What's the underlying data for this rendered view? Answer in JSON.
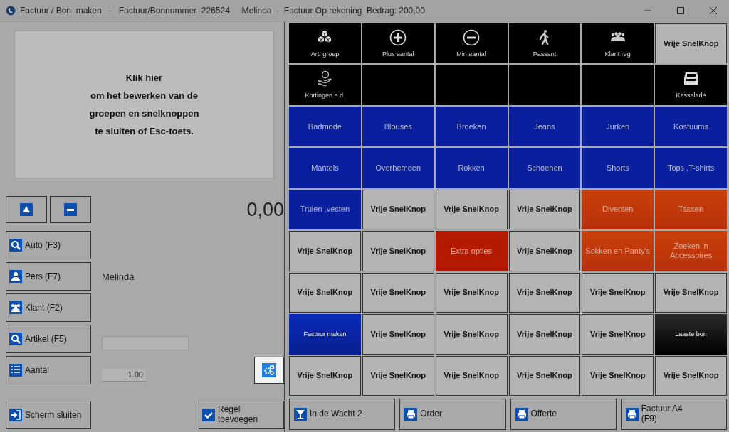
{
  "window": {
    "title": "Factuur / Bon  maken   -   Factuur/Bonnummer  226524     Melinda  -  Factuur Op rekening  Bedrag: 200,00"
  },
  "info": {
    "lines": [
      "Klik hier",
      "om het bewerken van de",
      "groepen en snelknoppen",
      "te sluiten of Esc-toets."
    ]
  },
  "amount": "0,00",
  "side_buttons": [
    {
      "label": "Auto (F3)"
    },
    {
      "label": "Pers (F7)"
    },
    {
      "label": "Klant (F2)"
    },
    {
      "label": "Artikel (F5)"
    },
    {
      "label": "Aantal"
    }
  ],
  "employee": "Melinda",
  "quantity": "1.00",
  "close_button": {
    "label": "Scherm sluiten"
  },
  "add_line_button": {
    "label": "Regel toevoegen"
  },
  "tiles": [
    {
      "kind": "icon",
      "label": "Art. groep"
    },
    {
      "kind": "icon",
      "label": "Plus aantal"
    },
    {
      "kind": "icon",
      "label": "Min aantal"
    },
    {
      "kind": "icon",
      "label": "Passant"
    },
    {
      "kind": "icon",
      "label": "Klant reg"
    },
    {
      "kind": "free",
      "label": "Vrije SnelKnop"
    },
    {
      "kind": "icon",
      "label": "Kortingen e.d."
    },
    {
      "kind": "empty"
    },
    {
      "kind": "empty"
    },
    {
      "kind": "empty"
    },
    {
      "kind": "empty"
    },
    {
      "kind": "icon",
      "label": "Kassalade"
    },
    {
      "kind": "blue",
      "label": "Badmode"
    },
    {
      "kind": "blue",
      "label": "Blouses"
    },
    {
      "kind": "blue",
      "label": "Broeken"
    },
    {
      "kind": "blue",
      "label": "Jeans"
    },
    {
      "kind": "blue",
      "label": "Jurken"
    },
    {
      "kind": "blue",
      "label": "Kostuums"
    },
    {
      "kind": "blue",
      "label": "Mantels"
    },
    {
      "kind": "blue",
      "label": "Overhemden"
    },
    {
      "kind": "blue",
      "label": "Rokken"
    },
    {
      "kind": "blue",
      "label": "Schoenen"
    },
    {
      "kind": "blue",
      "label": "Shorts"
    },
    {
      "kind": "blue",
      "label": "Tops ,T-shirts"
    },
    {
      "kind": "blue",
      "label": "Truien ,vesten"
    },
    {
      "kind": "free",
      "label": "Vrije SnelKnop"
    },
    {
      "kind": "free",
      "label": "Vrije SnelKnop"
    },
    {
      "kind": "free",
      "label": "Vrije SnelKnop"
    },
    {
      "kind": "orange",
      "label": "Diversen"
    },
    {
      "kind": "orange",
      "label": "Tassen"
    },
    {
      "kind": "free",
      "label": "Vrije SnelKnop"
    },
    {
      "kind": "free",
      "label": "Vrije SnelKnop"
    },
    {
      "kind": "red",
      "label": "Extra opties"
    },
    {
      "kind": "free",
      "label": "Vrije SnelKnop"
    },
    {
      "kind": "orange",
      "label": "Sokken en Panty's"
    },
    {
      "kind": "orange",
      "label": "Zoeken in Accessoires"
    },
    {
      "kind": "free",
      "label": "Vrije SnelKnop"
    },
    {
      "kind": "free",
      "label": "Vrije SnelKnop"
    },
    {
      "kind": "free",
      "label": "Vrije SnelKnop"
    },
    {
      "kind": "free",
      "label": "Vrije SnelKnop"
    },
    {
      "kind": "free",
      "label": "Vrije SnelKnop"
    },
    {
      "kind": "free",
      "label": "Vrije SnelKnop"
    },
    {
      "kind": "action",
      "label": "Factuur maken"
    },
    {
      "kind": "free",
      "label": "Vrije SnelKnop"
    },
    {
      "kind": "free",
      "label": "Vrije SnelKnop"
    },
    {
      "kind": "free",
      "label": "Vrije SnelKnop"
    },
    {
      "kind": "free",
      "label": "Vrije SnelKnop"
    },
    {
      "kind": "dark",
      "label": "Laaste bon"
    },
    {
      "kind": "free",
      "label": "Vrije SnelKnop"
    },
    {
      "kind": "free",
      "label": "Vrije SnelKnop"
    },
    {
      "kind": "free",
      "label": "Vrije SnelKnop"
    },
    {
      "kind": "free",
      "label": "Vrije SnelKnop"
    },
    {
      "kind": "free",
      "label": "Vrije SnelKnop"
    },
    {
      "kind": "free",
      "label": "Vrije SnelKnop"
    }
  ],
  "bottom_buttons": [
    {
      "label": "In de Wacht 2"
    },
    {
      "label": "Order"
    },
    {
      "label": "Offerte"
    },
    {
      "label": "Factuur A4\n(F9)"
    }
  ]
}
